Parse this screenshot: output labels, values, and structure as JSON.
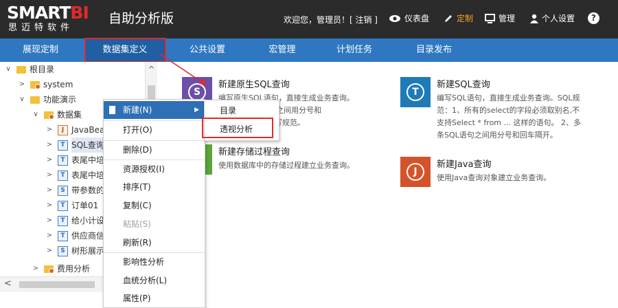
{
  "logo": {
    "brand_a": "SMART",
    "brand_b": "BI",
    "sub": "思迈特软件"
  },
  "app_title": "自助分析版",
  "top_right": {
    "welcome": "欢迎您，管理员！[ 注销 ]",
    "links": [
      {
        "label": "仪表盘",
        "icon": "eye-icon",
        "active": false
      },
      {
        "label": "定制",
        "icon": "pencil-icon",
        "active": true
      },
      {
        "label": "管理",
        "icon": "monitor-icon",
        "active": false
      },
      {
        "label": "个人设置",
        "icon": "user-icon",
        "active": false
      }
    ],
    "help": "?"
  },
  "nav": {
    "items": [
      "展现定制",
      "数据集定义",
      "公共设置",
      "宏管理",
      "计划任务",
      "目录发布"
    ],
    "active": "数据集定义"
  },
  "tree": {
    "items": [
      {
        "label": "根目录",
        "kind": "folder",
        "toggle": "∨"
      },
      {
        "label": "system",
        "kind": "folder-badge",
        "toggle": ">"
      },
      {
        "label": "功能演示",
        "kind": "folder",
        "toggle": "∨"
      },
      {
        "label": "数据集",
        "kind": "folder-badge",
        "toggle": "∨"
      },
      {
        "label": "JavaBea",
        "kind": "J",
        "toggle": ">"
      },
      {
        "label": "SQL查询",
        "kind": "T",
        "toggle": ">"
      },
      {
        "label": "表尾中培",
        "kind": "T",
        "toggle": ">"
      },
      {
        "label": "表尾中培",
        "kind": "T",
        "toggle": ">"
      },
      {
        "label": "带参数的",
        "kind": "S",
        "toggle": ">"
      },
      {
        "label": "订单01",
        "kind": "T",
        "toggle": ">"
      },
      {
        "label": "给小计设",
        "kind": "T",
        "toggle": ">"
      },
      {
        "label": "供应商信",
        "kind": "T",
        "toggle": ">"
      },
      {
        "label": "树形展示",
        "kind": "S",
        "toggle": ">"
      },
      {
        "label": "费用分析",
        "kind": "folder-badge",
        "toggle": ">"
      }
    ]
  },
  "cards": [
    {
      "title": "新建原生SQL查询",
      "desc": [
        "编写原生SQL语句，直接生成业务查询。",
        "L语句之间用分号和",
        "QL书写规范。"
      ],
      "icon_letter": "S",
      "color": "#6b4fa8"
    },
    {
      "title": "新建SQL查询",
      "desc": [
        "编写SQL语句，直接生成业务查询。SQL规",
        "范：1、所有的select的字段必须取别名,不",
        "支持Select * from ... 这样的语句。 2、多",
        "条SQL语句之间用分号和回车隔开。"
      ],
      "icon_letter": "T",
      "color": "#1f7ab8"
    },
    {
      "title": "新建存储过程查询",
      "desc": [
        "使用数据库中的存储过程建立业务查询。"
      ],
      "icon_letter": "",
      "color": "#5aa63a"
    },
    {
      "title": "新建Java查询",
      "desc": [
        "使用Java查询对象建立业务查询。"
      ],
      "icon_letter": "J",
      "color": "#d5532a"
    }
  ],
  "context_menu": {
    "items": [
      {
        "label": "新建(N)",
        "state": "hover",
        "submenu": true
      },
      {
        "label": "打开(O)",
        "state": "normal"
      },
      {
        "label": "删除(D)",
        "state": "normal"
      },
      {
        "label": "资源授权(I)",
        "state": "normal"
      },
      {
        "label": "排序(T)",
        "state": "normal"
      },
      {
        "label": "复制(C)",
        "state": "normal"
      },
      {
        "label": "粘贴(S)",
        "state": "disabled"
      },
      {
        "label": "刷新(R)",
        "state": "normal"
      },
      {
        "label": "影响性分析",
        "state": "normal"
      },
      {
        "label": "血统分析(L)",
        "state": "normal"
      },
      {
        "label": "属性(P)",
        "state": "normal"
      }
    ],
    "submenu": [
      "目录",
      "透视分析"
    ]
  },
  "colors": {
    "topbar": "#2b2b2b",
    "nav": "#2f78c1",
    "highlight": "#e02a2a",
    "accent": "#f5a623"
  }
}
